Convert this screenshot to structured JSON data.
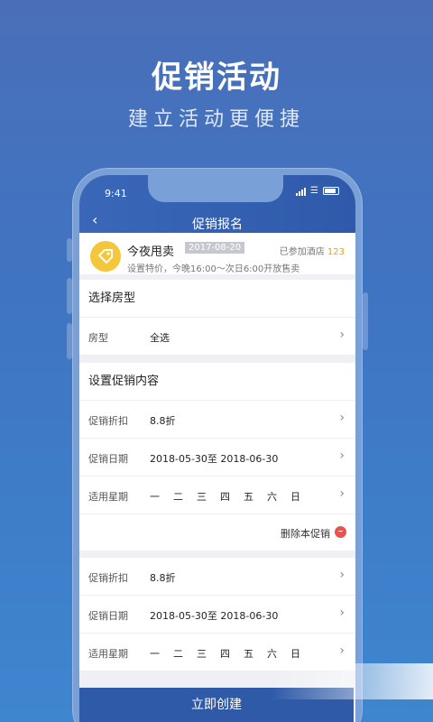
{
  "hero": {
    "title": "促销活动",
    "subtitle": "建立活动更便捷"
  },
  "status_bar": {
    "time": "9:41"
  },
  "nav": {
    "title": "促销报名"
  },
  "promo": {
    "title": "今夜甩卖",
    "date": "2017-08-20",
    "joined_label": "已参加酒店",
    "joined_count": "123",
    "description": "设置特价，今晚16:00～次日6:00开放售卖"
  },
  "room_section": {
    "header": "选择房型",
    "row": {
      "label": "房型",
      "value": "全选"
    }
  },
  "promo_section": {
    "header": "设置促销内容",
    "blocks": [
      {
        "discount_label": "促销折扣",
        "discount_value": "8.8折",
        "date_label": "促销日期",
        "date_value": "2018-05-30至 2018-06-30",
        "weekday_label": "适用星期"
      },
      {
        "discount_label": "促销折扣",
        "discount_value": "8.8折",
        "date_label": "促销日期",
        "date_value": "2018-05-30至 2018-06-30",
        "weekday_label": "适用星期"
      }
    ],
    "weekdays": [
      "一",
      "二",
      "三",
      "四",
      "五",
      "六",
      "日"
    ],
    "delete_label": "删除本促销"
  },
  "footer": {
    "create_label": "立即创建"
  },
  "colors": {
    "accent": "#2e5aa8",
    "badge": "#f4c63a",
    "delete": "#e8534f"
  }
}
